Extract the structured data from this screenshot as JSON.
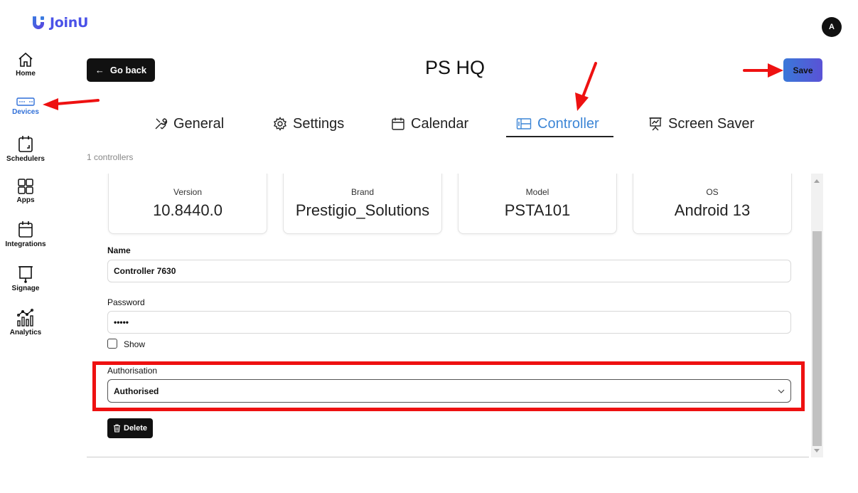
{
  "app": {
    "name": "JoinU",
    "avatar_initial": "A"
  },
  "colors": {
    "accent": "#3d86d6",
    "brand": "#4a52e8",
    "annotation": "#ee1111"
  },
  "sidebar": {
    "items": [
      {
        "label": "Home",
        "icon": "home-icon"
      },
      {
        "label": "Devices",
        "icon": "device-icon",
        "active": true
      },
      {
        "label": "Schedulers",
        "icon": "scheduler-icon"
      },
      {
        "label": "Apps",
        "icon": "apps-icon"
      },
      {
        "label": "Integrations",
        "icon": "integrations-icon"
      },
      {
        "label": "Signage",
        "icon": "signage-icon"
      },
      {
        "label": "Analytics",
        "icon": "analytics-icon"
      }
    ]
  },
  "header": {
    "back_label": "Go back",
    "title": "PS HQ",
    "save_label": "Save"
  },
  "tabs": [
    {
      "label": "General",
      "icon": "tools-icon"
    },
    {
      "label": "Settings",
      "icon": "gear-icon"
    },
    {
      "label": "Calendar",
      "icon": "calendar-icon"
    },
    {
      "label": "Controller",
      "icon": "controller-icon",
      "active": true
    },
    {
      "label": "Screen Saver",
      "icon": "screensaver-icon"
    }
  ],
  "controllers_count": "1 controllers",
  "info_cards": [
    {
      "label": "Version",
      "value": "10.8440.0"
    },
    {
      "label": "Brand",
      "value": "Prestigio_Solutions"
    },
    {
      "label": "Model",
      "value": "PSTA101"
    },
    {
      "label": "OS",
      "value": "Android 13"
    }
  ],
  "form": {
    "name_label": "Name",
    "name_value": "Controller 7630",
    "password_label": "Password",
    "password_value": "•••••",
    "show_label": "Show",
    "show_checked": false,
    "authorisation_label": "Authorisation",
    "authorisation_value": "Authorised",
    "delete_label": "Delete"
  }
}
